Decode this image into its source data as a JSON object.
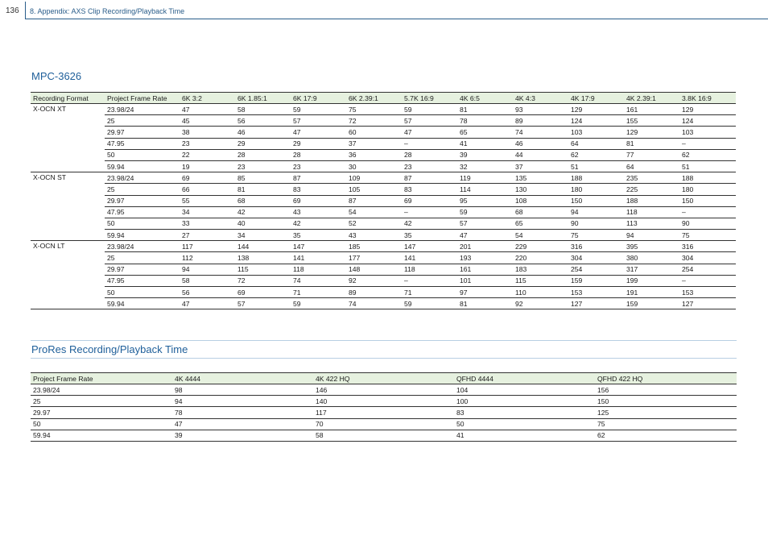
{
  "header": {
    "page_number": "136",
    "chapter_title": "8. Appendix: AXS Clip Recording/Playback Time"
  },
  "mpc": {
    "title": "MPC-3626",
    "columns": [
      "Recording Format",
      "Project Frame Rate",
      "6K 3:2",
      "6K 1.85:1",
      "6K 17:9",
      "6K 2.39:1",
      "5.7K 16:9",
      "4K 6:5",
      "4K 4:3",
      "4K 17:9",
      "4K 2.39:1",
      "3.8K 16:9"
    ],
    "groups": [
      {
        "format": "X-OCN XT",
        "rows": [
          [
            "23.98/24",
            "47",
            "58",
            "59",
            "75",
            "59",
            "81",
            "93",
            "129",
            "161",
            "129"
          ],
          [
            "25",
            "45",
            "56",
            "57",
            "72",
            "57",
            "78",
            "89",
            "124",
            "155",
            "124"
          ],
          [
            "29.97",
            "38",
            "46",
            "47",
            "60",
            "47",
            "65",
            "74",
            "103",
            "129",
            "103"
          ],
          [
            "47.95",
            "23",
            "29",
            "29",
            "37",
            "–",
            "41",
            "46",
            "64",
            "81",
            "–"
          ],
          [
            "50",
            "22",
            "28",
            "28",
            "36",
            "28",
            "39",
            "44",
            "62",
            "77",
            "62"
          ],
          [
            "59.94",
            "19",
            "23",
            "23",
            "30",
            "23",
            "32",
            "37",
            "51",
            "64",
            "51"
          ]
        ]
      },
      {
        "format": "X-OCN ST",
        "rows": [
          [
            "23.98/24",
            "69",
            "85",
            "87",
            "109",
            "87",
            "119",
            "135",
            "188",
            "235",
            "188"
          ],
          [
            "25",
            "66",
            "81",
            "83",
            "105",
            "83",
            "114",
            "130",
            "180",
            "225",
            "180"
          ],
          [
            "29.97",
            "55",
            "68",
            "69",
            "87",
            "69",
            "95",
            "108",
            "150",
            "188",
            "150"
          ],
          [
            "47.95",
            "34",
            "42",
            "43",
            "54",
            "–",
            "59",
            "68",
            "94",
            "118",
            "–"
          ],
          [
            "50",
            "33",
            "40",
            "42",
            "52",
            "42",
            "57",
            "65",
            "90",
            "113",
            "90"
          ],
          [
            "59.94",
            "27",
            "34",
            "35",
            "43",
            "35",
            "47",
            "54",
            "75",
            "94",
            "75"
          ]
        ]
      },
      {
        "format": "X-OCN LT",
        "rows": [
          [
            "23.98/24",
            "117",
            "144",
            "147",
            "185",
            "147",
            "201",
            "229",
            "316",
            "395",
            "316"
          ],
          [
            "25",
            "112",
            "138",
            "141",
            "177",
            "141",
            "193",
            "220",
            "304",
            "380",
            "304"
          ],
          [
            "29.97",
            "94",
            "115",
            "118",
            "148",
            "118",
            "161",
            "183",
            "254",
            "317",
            "254"
          ],
          [
            "47.95",
            "58",
            "72",
            "74",
            "92",
            "–",
            "101",
            "115",
            "159",
            "199",
            "–"
          ],
          [
            "50",
            "56",
            "69",
            "71",
            "89",
            "71",
            "97",
            "110",
            "153",
            "191",
            "153"
          ],
          [
            "59.94",
            "47",
            "57",
            "59",
            "74",
            "59",
            "81",
            "92",
            "127",
            "159",
            "127"
          ]
        ]
      }
    ]
  },
  "prores": {
    "title": "ProRes Recording/Playback Time",
    "columns": [
      "Project Frame Rate",
      "4K 4444",
      "4K 422 HQ",
      "QFHD 4444",
      "QFHD 422 HQ"
    ],
    "rows": [
      [
        "23.98/24",
        "98",
        "146",
        "104",
        "156"
      ],
      [
        "25",
        "94",
        "140",
        "100",
        "150"
      ],
      [
        "29.97",
        "78",
        "117",
        "83",
        "125"
      ],
      [
        "50",
        "47",
        "70",
        "50",
        "75"
      ],
      [
        "59.94",
        "39",
        "58",
        "41",
        "62"
      ]
    ]
  }
}
